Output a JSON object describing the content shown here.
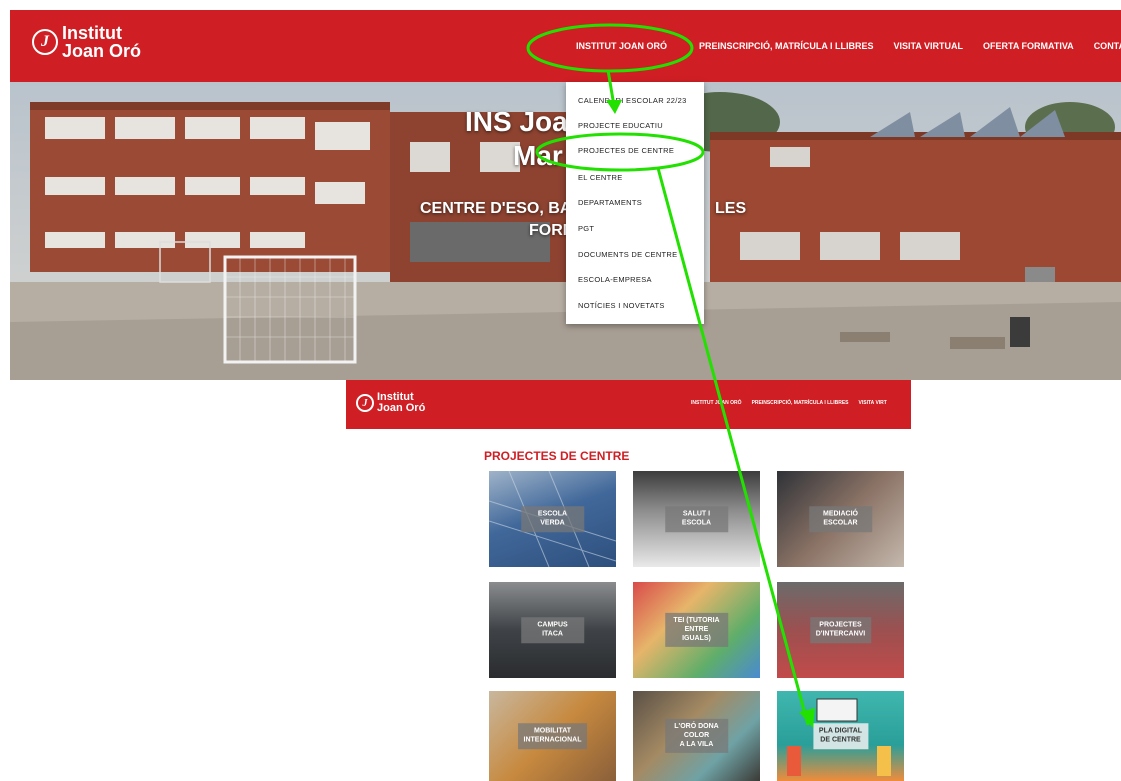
{
  "header": {
    "logo_line1": "Institut",
    "logo_line2": "Joan Oró",
    "logo_mark": "J",
    "nav": [
      {
        "label": "INSTITUT JOAN ORÓ"
      },
      {
        "label": "PREINSCRIPCIÓ, MATRÍCULA I LLIBRES"
      },
      {
        "label": "VISITA VIRTUAL"
      },
      {
        "label": "OFERTA FORMATIVA"
      },
      {
        "label": "CONTACTE"
      }
    ]
  },
  "hero": {
    "title_line1": "INS Joan",
    "title_line2": "Mar",
    "subtitle_line1": "CENTRE D'ESO, BA",
    "subtitle_line1b": "LES",
    "subtitle_line2": "FORM"
  },
  "dropdown": {
    "items": [
      {
        "label": "CALENDARI ESCOLAR 22/23"
      },
      {
        "label": "PROJECTE EDUCATIU"
      },
      {
        "label": "PROJECTES DE CENTRE"
      },
      {
        "label": "EL CENTRE"
      },
      {
        "label": "DEPARTAMENTS"
      },
      {
        "label": "PGT"
      },
      {
        "label": "DOCUMENTS DE CENTRE"
      },
      {
        "label": "ESCOLA-EMPRESA"
      },
      {
        "label": "NOTÍCIES I NOVETATS"
      }
    ]
  },
  "small_header": {
    "logo_line1": "Institut",
    "logo_line2": "Joan Oró",
    "nav": [
      {
        "label": "INSTITUT JOAN ORÓ"
      },
      {
        "label": "PREINSCRIPCIÓ, MATRÍCULA I LLIBRES"
      },
      {
        "label": "VISITA VIRT"
      }
    ]
  },
  "section": {
    "title": "PROJECTES DE CENTRE",
    "tiles": [
      {
        "label": "ESCOLA VERDA"
      },
      {
        "label": "SALUT I ESCOLA"
      },
      {
        "label": "MEDIACIÓ ESCOLAR"
      },
      {
        "label": "CAMPUS ITACA"
      },
      {
        "label": "TEI (TUTORIA ENTRE\nIGUALS)"
      },
      {
        "label": "PROJECTES\nD'INTERCANVI"
      },
      {
        "label": "MOBILITAT\nINTERNACIONAL"
      },
      {
        "label": "L'ORÓ DONA COLOR\nA LA VILA"
      },
      {
        "label": "PLA DIGITAL\nDE CENTRE"
      }
    ]
  },
  "colors": {
    "brand_red": "#cf1f24",
    "annotation_green": "#22e000"
  }
}
